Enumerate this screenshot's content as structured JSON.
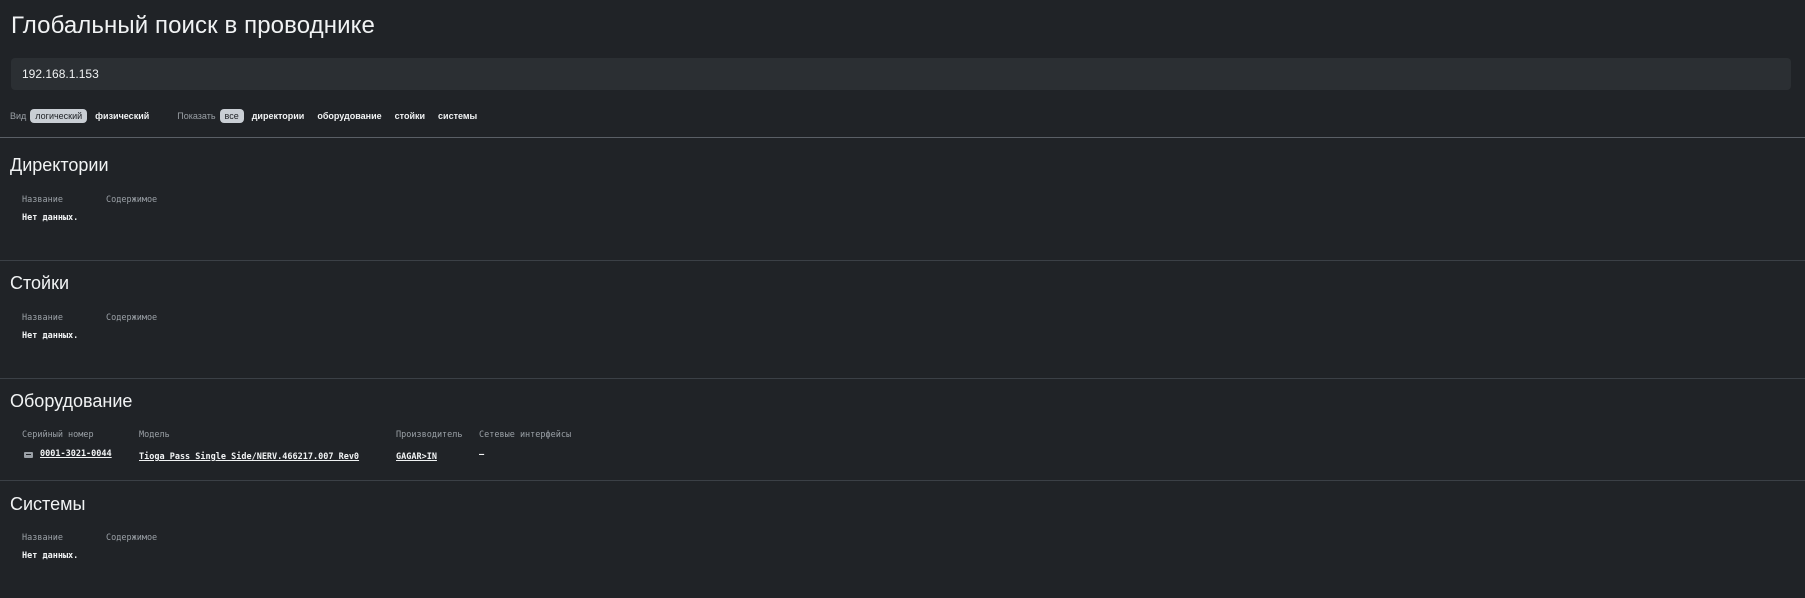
{
  "page": {
    "title": "Глобальный поиск в проводнике"
  },
  "search": {
    "value": "192.168.1.153"
  },
  "filters": {
    "view_label": "Вид",
    "view_options": [
      "логический",
      "физический"
    ],
    "view_selected": "логический",
    "show_label": "Показать",
    "show_options": [
      "все",
      "директории",
      "оборудование",
      "стойки",
      "системы"
    ],
    "show_selected": "все"
  },
  "sections": {
    "directories": {
      "title": "Директории",
      "columns": [
        "Название",
        "Содержимое"
      ],
      "empty": "Нет данных."
    },
    "racks": {
      "title": "Стойки",
      "columns": [
        "Название",
        "Содержимое"
      ],
      "empty": "Нет данных."
    },
    "equipment": {
      "title": "Оборудование",
      "columns": [
        "Серийный номер",
        "Модель",
        "Производитель",
        "Сетевые интерфейсы"
      ],
      "rows": [
        {
          "icon": "server-icon",
          "serial": "0001-3021-0044",
          "model": "Tioga Pass Single Side/NERV.466217.007 Rev0",
          "vendor": "GAGAR>IN",
          "interfaces": "—"
        }
      ]
    },
    "systems": {
      "title": "Системы",
      "columns": [
        "Название",
        "Содержимое"
      ],
      "empty": "Нет данных."
    }
  }
}
